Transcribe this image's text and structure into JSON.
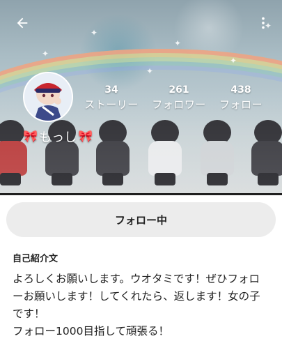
{
  "topbar": {
    "back_icon": "arrow-left-icon",
    "menu_icon": "more-vertical-icon"
  },
  "profile": {
    "username_prefix_icon": "ribbon-bow-icon",
    "username": "もっし",
    "username_suffix_icon": "ribbon-bow-icon",
    "avatar_icon": "avatar-illustration"
  },
  "stats": [
    {
      "count": "34",
      "label": "ストーリー"
    },
    {
      "count": "261",
      "label": "フォロワー"
    },
    {
      "count": "438",
      "label": "フォロー"
    }
  ],
  "follow_button": {
    "label": "フォロー中"
  },
  "bio": {
    "title": "自己紹介文",
    "text": "よろしくお願いします。ウオタミです！ぜひフォローお願いします！してくれたら、返します！女の子です！\nフォロー1000目指して頑張る！"
  },
  "colors": {
    "accent": "#e3242b",
    "button_bg": "#ececec",
    "header_line": "#1f1f1f"
  }
}
